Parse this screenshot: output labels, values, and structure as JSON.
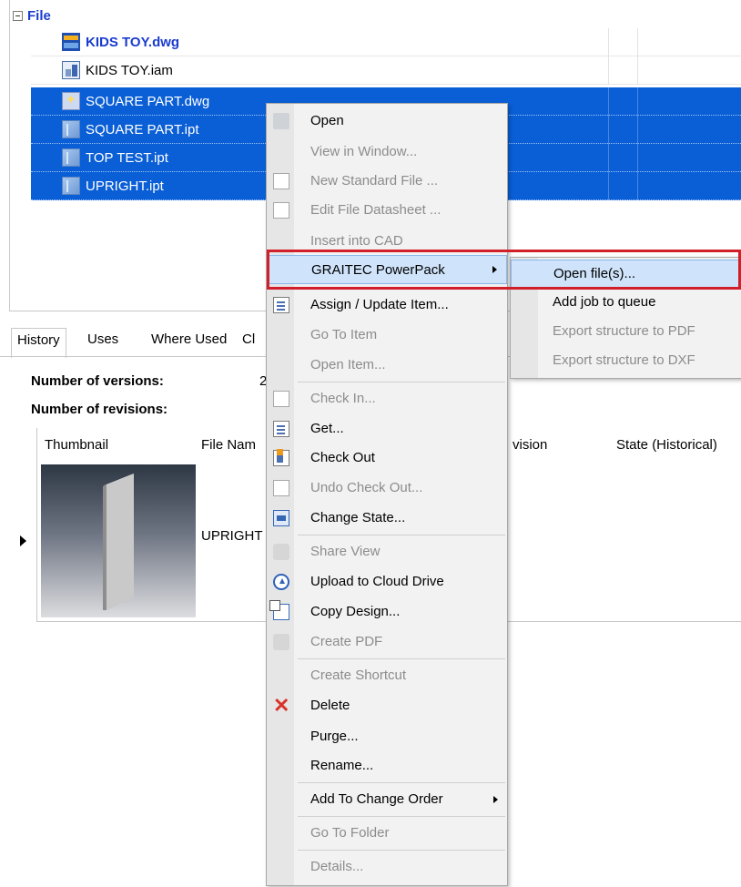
{
  "tree": {
    "group_label": "File",
    "files": [
      {
        "name": "KIDS TOY.dwg",
        "icon": "dwg-file-icon",
        "selected": false,
        "bold": true
      },
      {
        "name": "KIDS TOY.iam",
        "icon": "assembly-file-icon",
        "selected": false,
        "bold": false
      },
      {
        "name": "SQUARE PART.dwg",
        "icon": "drawing-file-icon",
        "selected": true,
        "bold": false
      },
      {
        "name": "SQUARE PART.ipt",
        "icon": "part-file-icon",
        "selected": true,
        "bold": false
      },
      {
        "name": "TOP TEST.ipt",
        "icon": "part-file-icon",
        "selected": true,
        "bold": false
      },
      {
        "name": "UPRIGHT.ipt",
        "icon": "part-file-icon",
        "selected": true,
        "bold": false
      }
    ]
  },
  "tabs": {
    "history": "History",
    "uses": "Uses",
    "where_used": "Where Used",
    "partial": "Cl"
  },
  "info": {
    "versions_label": "Number of versions:",
    "versions_value": "2",
    "revisions_label": "Number of revisions:"
  },
  "grid": {
    "col_thumbnail": "Thumbnail",
    "col_file_name": "File Nam",
    "col_revision": "vision",
    "col_state": "State (Historical)",
    "row_file_name": "UPRIGHT"
  },
  "menu": {
    "items": [
      {
        "label": "Open",
        "icon": "open-folder-icon",
        "disabled": false
      },
      {
        "label": "View in Window...",
        "icon": "",
        "disabled": true
      },
      {
        "label": "New Standard File ...",
        "icon": "new-file-icon",
        "disabled": true
      },
      {
        "label": "Edit File Datasheet ...",
        "icon": "datasheet-icon",
        "disabled": true
      },
      {
        "label": "Insert into CAD",
        "icon": "",
        "disabled": true
      },
      {
        "label": "GRAITEC PowerPack",
        "icon": "",
        "disabled": false,
        "submenu": true
      },
      {
        "label": "Assign / Update Item...",
        "icon": "assign-item-icon",
        "disabled": false
      },
      {
        "label": "Go To Item",
        "icon": "",
        "disabled": true
      },
      {
        "label": "Open Item...",
        "icon": "",
        "disabled": true
      },
      {
        "label": "Check In...",
        "icon": "check-in-icon",
        "disabled": true
      },
      {
        "label": "Get...",
        "icon": "get-icon",
        "disabled": false
      },
      {
        "label": "Check Out",
        "icon": "check-out-icon",
        "disabled": false
      },
      {
        "label": "Undo Check Out...",
        "icon": "undo-check-out-icon",
        "disabled": true
      },
      {
        "label": "Change State...",
        "icon": "change-state-icon",
        "disabled": false
      },
      {
        "label": "Share View",
        "icon": "share-view-icon",
        "disabled": true
      },
      {
        "label": "Upload to Cloud Drive",
        "icon": "cloud-upload-icon",
        "disabled": false
      },
      {
        "label": "Copy Design...",
        "icon": "copy-design-icon",
        "disabled": false
      },
      {
        "label": "Create PDF",
        "icon": "pdf-icon",
        "disabled": true
      },
      {
        "label": "Create Shortcut",
        "icon": "",
        "disabled": true
      },
      {
        "label": "Delete",
        "icon": "delete-x-icon",
        "disabled": false
      },
      {
        "label": "Purge...",
        "icon": "",
        "disabled": false
      },
      {
        "label": "Rename...",
        "icon": "",
        "disabled": false
      },
      {
        "label": "Add To Change Order",
        "icon": "",
        "disabled": false,
        "submenu": true
      },
      {
        "label": "Go To Folder",
        "icon": "",
        "disabled": true
      },
      {
        "label": "Details...",
        "icon": "",
        "disabled": true
      }
    ]
  },
  "submenu": {
    "items": [
      {
        "label": "Open file(s)...",
        "disabled": false
      },
      {
        "label": "Add job to queue",
        "disabled": false
      },
      {
        "label": "Export structure to PDF",
        "disabled": true
      },
      {
        "label": "Export structure to DXF",
        "disabled": true
      }
    ]
  },
  "colors": {
    "selection": "#0a5fd6",
    "highlight": "#cfe3fa",
    "annotation_frame": "#d2202a",
    "link_blue": "#1a3ccf"
  }
}
